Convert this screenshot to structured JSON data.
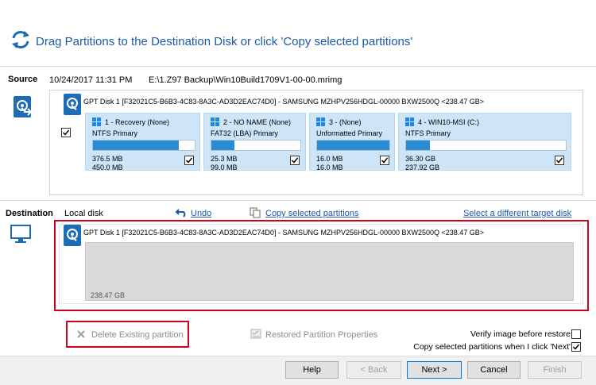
{
  "header": {
    "title": "Drag Partitions to the Destination Disk or click 'Copy selected partitions'",
    "icon": "sync-arrows-icon"
  },
  "source": {
    "label": "Source",
    "datetime": "10/24/2017 11:31 PM",
    "path": "E:\\1.Z97 Backup\\Win10Build1709V1-00-00.mrimg",
    "disk_title": "GPT Disk 1 [F32021C5-B6B3-4C83-8A3C-AD3D2EAC74D0] - SAMSUNG MZHPV256HDGL-00000 BXW2500Q  <238.47 GB>",
    "disk_checked": true,
    "partitions": [
      {
        "name": "1 - Recovery (None)",
        "type": "NTFS Primary",
        "used": "376.5 MB",
        "total": "450.0 MB",
        "fill": 0.84,
        "checked": true
      },
      {
        "name": "2 - NO NAME (None)",
        "type": "FAT32 (LBA) Primary",
        "used": "25.3 MB",
        "total": "99.0 MB",
        "fill": 0.26,
        "checked": true
      },
      {
        "name": "3 -  (None)",
        "type": "Unformatted Primary",
        "used": "16.0 MB",
        "total": "16.0 MB",
        "fill": 1.0,
        "checked": true
      },
      {
        "name": "4 - WIN10-MSI (C:)",
        "type": "NTFS Primary",
        "used": "36.30 GB",
        "total": "237.92 GB",
        "fill": 0.15,
        "checked": true
      }
    ]
  },
  "destination": {
    "label": "Destination",
    "disk_type": "Local disk",
    "undo": "Undo",
    "copy_selected": "Copy selected partitions",
    "select_target": "Select a different target disk",
    "disk_title": "GPT Disk 1 [F32021C5-B6B3-4C83-8A3C-AD3D2EAC74D0] - SAMSUNG MZHPV256HDGL-00000 BXW2500Q  <238.47 GB>",
    "size": "238.47 GB"
  },
  "options": {
    "delete_existing": "Delete Existing partition",
    "restored_props": "Restored Partition Properties",
    "verify_label": "Verify image before restore",
    "verify_checked": false,
    "copy_next_label": "Copy selected partitions when I click 'Next'",
    "copy_next_checked": true
  },
  "buttons": {
    "help": "Help",
    "back": "< Back",
    "next": "Next >",
    "cancel": "Cancel",
    "finish": "Finish"
  },
  "colors": {
    "accent": "#1a5aa6",
    "partition_bg": "#cde5f7",
    "bar_fill": "#2a8ad4",
    "highlight": "#d0021b"
  }
}
